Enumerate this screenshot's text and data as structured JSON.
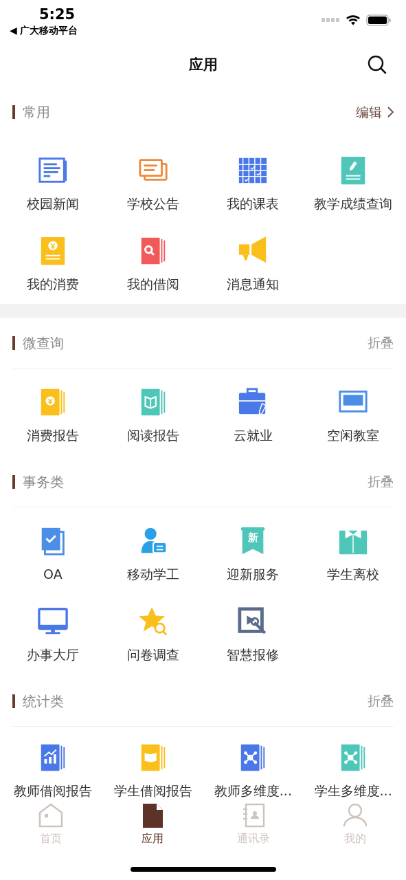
{
  "status_bar": {
    "time": "5:25",
    "back_arrow": "◀",
    "back_app": "广大移动平台"
  },
  "header": {
    "title": "应用"
  },
  "sections": [
    {
      "title": "常用",
      "action": {
        "kind": "edit",
        "label": "编辑"
      },
      "apps": [
        {
          "label": "校园新闻",
          "color": "#4a78e8"
        },
        {
          "label": "学校公告",
          "color": "#ef8a3c"
        },
        {
          "label": "我的课表",
          "color": "#4a78e8"
        },
        {
          "label": "教学成绩查询",
          "color": "#4ec6b8"
        },
        {
          "label": "我的消费",
          "color": "#fbbf1b"
        },
        {
          "label": "我的借阅",
          "color": "#f25a5a"
        },
        {
          "label": "消息通知",
          "color": "#fbbf1b"
        }
      ]
    },
    {
      "title": "微查询",
      "action": {
        "kind": "collapse",
        "label": "折叠"
      },
      "apps": [
        {
          "label": "消费报告",
          "color": "#fbbf1b"
        },
        {
          "label": "阅读报告",
          "color": "#4ec6b8"
        },
        {
          "label": "云就业",
          "color": "#4a78e8"
        },
        {
          "label": "空闲教室",
          "color": "#4a8ee8"
        }
      ]
    },
    {
      "title": "事务类",
      "action": {
        "kind": "collapse",
        "label": "折叠"
      },
      "apps": [
        {
          "label": "OA",
          "color": "#4a8ee8"
        },
        {
          "label": "移动学工",
          "color": "#2aa0e6"
        },
        {
          "label": "迎新服务",
          "color": "#4ec6b8",
          "icon_text": "新"
        },
        {
          "label": "学生离校",
          "color": "#4ec6b8"
        },
        {
          "label": "办事大厅",
          "color": "#4a78e8"
        },
        {
          "label": "问卷调查",
          "color": "#fbbf1b"
        },
        {
          "label": "智慧报修",
          "color": "#5a6b8c"
        }
      ]
    },
    {
      "title": "统计类",
      "action": {
        "kind": "collapse",
        "label": "折叠"
      },
      "apps": [
        {
          "label": "教师借阅报告",
          "color": "#4a78e8"
        },
        {
          "label": "学生借阅报告",
          "color": "#fbbf1b"
        },
        {
          "label": "教师多维度...",
          "color": "#4a78e8"
        },
        {
          "label": "学生多维度...",
          "color": "#4ec6b8"
        }
      ]
    }
  ],
  "tabs": [
    {
      "label": "首页",
      "selected": false
    },
    {
      "label": "应用",
      "selected": true
    },
    {
      "label": "通讯录",
      "selected": false
    },
    {
      "label": "我的",
      "selected": false
    }
  ]
}
